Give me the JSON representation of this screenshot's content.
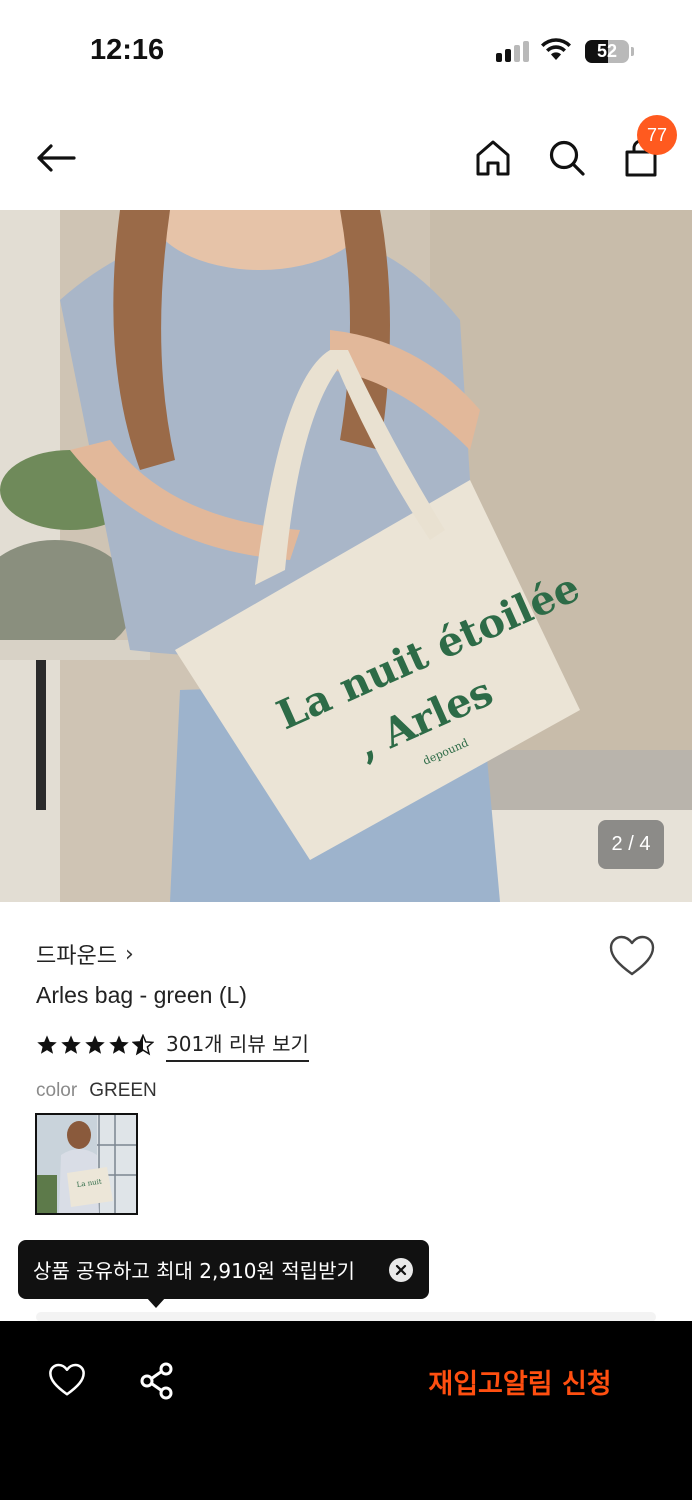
{
  "status_bar": {
    "time": "12:16",
    "battery": "52",
    "battery_level": 0.52
  },
  "nav": {
    "back_icon": "back-arrow-icon",
    "home_icon": "home-icon",
    "search_icon": "search-icon",
    "cart_icon": "shopping-bag-icon",
    "cart_count": "77"
  },
  "image": {
    "counter": "2 / 4",
    "bag_text_line1": "La nuit étoilée",
    "bag_text_line2": ", Arles",
    "bag_text_small": "depound"
  },
  "product": {
    "brand": "드파운드",
    "brand_chevron": "›",
    "name": "Arles bag - green (L)",
    "rating": 4.5,
    "review_link": "301개 리뷰 보기",
    "color_label": "color",
    "color_value": "GREEN"
  },
  "tooltip": {
    "text": "상품 공유하고 최대 2,910원 적립받기"
  },
  "bottom_bar": {
    "restock_label": "재입고알림 신청"
  },
  "colors": {
    "accent": "#ff5a1f",
    "restock": "#ff4f10",
    "bag_text": "#2d6b47"
  }
}
